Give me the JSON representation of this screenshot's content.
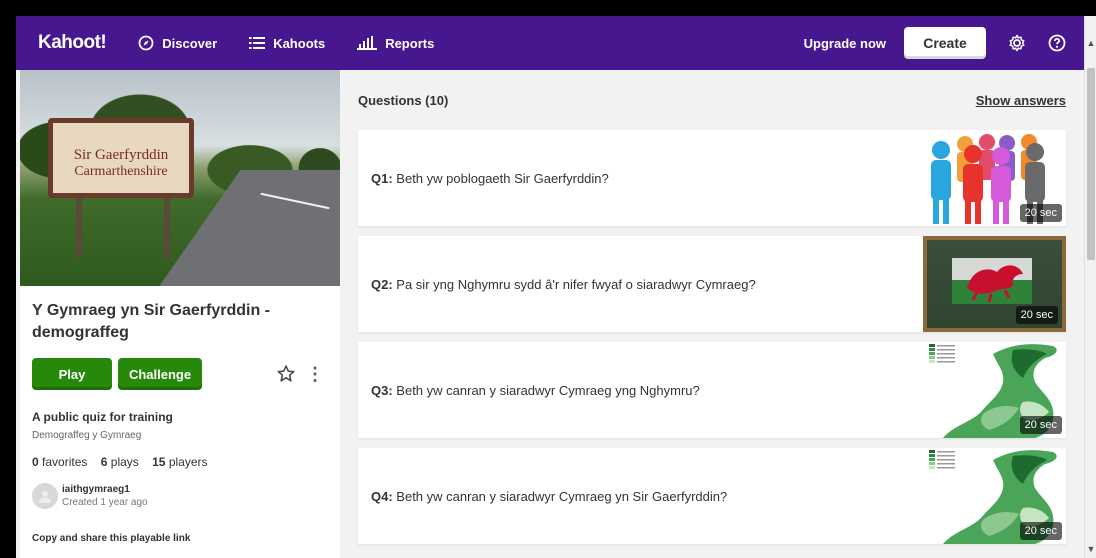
{
  "nav": {
    "logo": "Kahoot!",
    "discover": "Discover",
    "kahoots": "Kahoots",
    "reports": "Reports",
    "upgrade": "Upgrade now",
    "create": "Create"
  },
  "kahoot": {
    "cover_sign_line1": "Sir Gaerfyrddin",
    "cover_sign_line2": "Carmarthenshire",
    "title": "Y Gymraeg yn Sir Gaerfyrddin - demograffeg",
    "play": "Play",
    "challenge": "Challenge",
    "description_title": "A public quiz for training",
    "description_sub": "Demograffeg y Gymraeg",
    "stats": {
      "favorites_count": "0",
      "favorites_label": "favorites",
      "plays_count": "6",
      "plays_label": "plays",
      "players_count": "15",
      "players_label": "players"
    },
    "creator_name": "iaithgymraeg1",
    "creator_date": "Created 1 year ago",
    "share_label": "Copy and share this playable link"
  },
  "questions": {
    "header": "Questions (10)",
    "show_answers": "Show answers",
    "items": [
      {
        "num": "Q1:",
        "text": "Beth yw poblogaeth Sir Gaerfyrddin?",
        "time": "20 sec",
        "image": "people-icon"
      },
      {
        "num": "Q2:",
        "text": "Pa sir yng Nghymru sydd â'r nifer fwyaf o siaradwyr Cymraeg?",
        "time": "20 sec",
        "image": "welsh-flag-icon"
      },
      {
        "num": "Q3:",
        "text": "Beth yw canran y siaradwyr Cymraeg yng Nghymru?",
        "time": "20 sec",
        "image": "wales-map-icon"
      },
      {
        "num": "Q4:",
        "text": "Beth yw canran y siaradwyr Cymraeg yn Sir Gaerfyrddin?",
        "time": "20 sec",
        "image": "wales-map-icon"
      }
    ]
  },
  "colors": {
    "nav_bg": "#46178f",
    "green": "#26890c"
  }
}
